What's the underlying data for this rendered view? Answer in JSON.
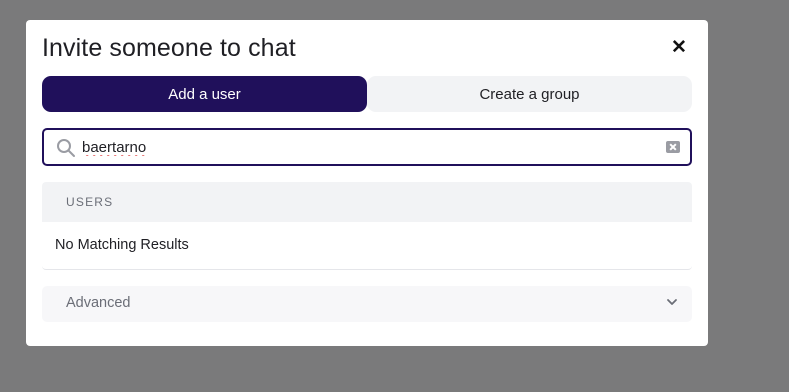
{
  "dialog": {
    "title": "Invite someone to chat",
    "close_icon": "close-icon"
  },
  "tabs": [
    {
      "label": "Add a user",
      "active": true
    },
    {
      "label": "Create a group",
      "active": false
    }
  ],
  "search": {
    "value": "baertarno",
    "icon": "search-icon",
    "clear_icon": "clear-input-icon"
  },
  "results": {
    "section_header": "USERS",
    "empty_message": "No Matching Results"
  },
  "advanced": {
    "label": "Advanced",
    "expanded": false
  },
  "colors": {
    "accent": "#20105b",
    "overlay": "#7a7a7b",
    "tab_inactive": "#f2f3f5"
  }
}
